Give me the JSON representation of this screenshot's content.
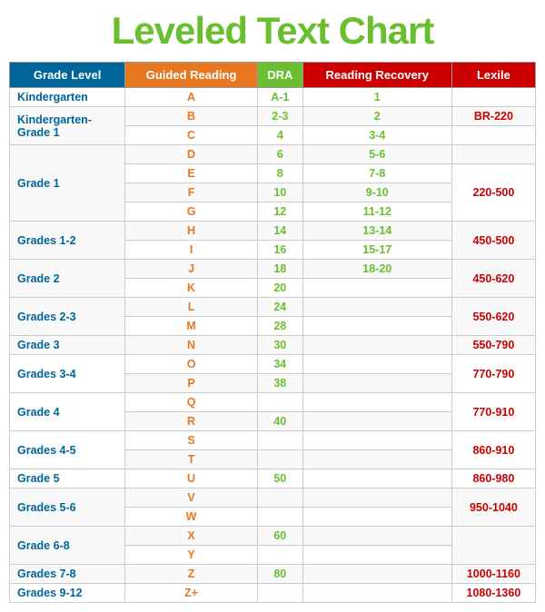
{
  "title": "Leveled Text Chart",
  "table": {
    "headers": {
      "grade": "Grade Level",
      "guided": "Guided Reading",
      "dra": "DRA",
      "recovery": "Reading Recovery",
      "lexile": "Lexile"
    },
    "rows": [
      {
        "grade": "Kindergarten",
        "guided": "A",
        "dra": "A-1",
        "recovery": "1",
        "lexile": ""
      },
      {
        "grade": "Kindergarten-\nGrade 1",
        "guided": "B",
        "dra": "2-3",
        "recovery": "2",
        "lexile": "BR-220"
      },
      {
        "grade": "",
        "guided": "C",
        "dra": "4",
        "recovery": "3-4",
        "lexile": ""
      },
      {
        "grade": "",
        "guided": "D",
        "dra": "6",
        "recovery": "5-6",
        "lexile": ""
      },
      {
        "grade": "Grade 1",
        "guided": "E",
        "dra": "8",
        "recovery": "7-8",
        "lexile": "220-500"
      },
      {
        "grade": "",
        "guided": "F",
        "dra": "10",
        "recovery": "9-10",
        "lexile": ""
      },
      {
        "grade": "",
        "guided": "G",
        "dra": "12",
        "recovery": "11-12",
        "lexile": ""
      },
      {
        "grade": "Grades 1-2",
        "guided": "H",
        "dra": "14",
        "recovery": "13-14",
        "lexile": "450-500"
      },
      {
        "grade": "",
        "guided": "I",
        "dra": "16",
        "recovery": "15-17",
        "lexile": ""
      },
      {
        "grade": "Grade 2",
        "guided": "J",
        "dra": "18",
        "recovery": "18-20",
        "lexile": "450-620"
      },
      {
        "grade": "",
        "guided": "K",
        "dra": "20",
        "recovery": "",
        "lexile": ""
      },
      {
        "grade": "Grades 2-3",
        "guided": "L",
        "dra": "24",
        "recovery": "",
        "lexile": "550-620"
      },
      {
        "grade": "",
        "guided": "M",
        "dra": "28",
        "recovery": "",
        "lexile": ""
      },
      {
        "grade": "Grade 3",
        "guided": "N",
        "dra": "30",
        "recovery": "",
        "lexile": "550-790"
      },
      {
        "grade": "Grades 3-4",
        "guided": "O",
        "dra": "34",
        "recovery": "",
        "lexile": "770-790"
      },
      {
        "grade": "",
        "guided": "P",
        "dra": "38",
        "recovery": "",
        "lexile": ""
      },
      {
        "grade": "Grade 4",
        "guided": "Q",
        "dra": "",
        "recovery": "",
        "lexile": "770-910"
      },
      {
        "grade": "",
        "guided": "R",
        "dra": "40",
        "recovery": "",
        "lexile": ""
      },
      {
        "grade": "Grades 4-5",
        "guided": "S",
        "dra": "",
        "recovery": "",
        "lexile": "860-910"
      },
      {
        "grade": "",
        "guided": "T",
        "dra": "",
        "recovery": "",
        "lexile": ""
      },
      {
        "grade": "Grade 5",
        "guided": "U",
        "dra": "50",
        "recovery": "",
        "lexile": "860-980"
      },
      {
        "grade": "Grades 5-6",
        "guided": "V",
        "dra": "",
        "recovery": "",
        "lexile": ""
      },
      {
        "grade": "",
        "guided": "W",
        "dra": "",
        "recovery": "",
        "lexile": "950-1040"
      },
      {
        "grade": "Grade 6-8",
        "guided": "X",
        "dra": "60",
        "recovery": "",
        "lexile": ""
      },
      {
        "grade": "",
        "guided": "Y",
        "dra": "",
        "recovery": "",
        "lexile": ""
      },
      {
        "grade": "Grades 7-8",
        "guided": "Z",
        "dra": "80",
        "recovery": "",
        "lexile": "1000-1160"
      },
      {
        "grade": "Grades 9-12",
        "guided": "Z+",
        "dra": "",
        "recovery": "",
        "lexile": "1080-1360"
      }
    ]
  }
}
